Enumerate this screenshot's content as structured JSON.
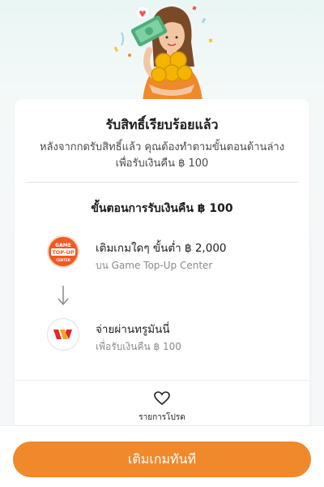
{
  "card": {
    "title": "รับสิทธิ์เรียบร้อยแล้ว",
    "description": "หลังจากกดรับสิทธิ์แล้ว คุณต้องทำตามขั้นตอนด้านล่าง เพื่อรับเงินคืน ฿ 100"
  },
  "steps": {
    "title": "ขั้นตอนการรับเงินคืน ฿ 100",
    "items": [
      {
        "main": "เติมเกมใดๆ ขั้นต่ำ ฿ 2,000",
        "sub": "บน Game Top-Up Center",
        "logo_text_top": "GAME",
        "logo_text_mid": "TOP-UP",
        "logo_text_bot": "CENTER"
      },
      {
        "main": "จ่ายผ่านทรูมันนี่",
        "sub": "เพื่อรับเงินคืน ฿ 100"
      }
    ]
  },
  "favorite": {
    "label": "รายการโปรด"
  },
  "cta": {
    "label": "เติมเกมทันที"
  },
  "colors": {
    "accent": "#f0892b",
    "game_logo": "#f05a23",
    "truemoney_red": "#e3262a",
    "truemoney_orange": "#f7a41d"
  }
}
